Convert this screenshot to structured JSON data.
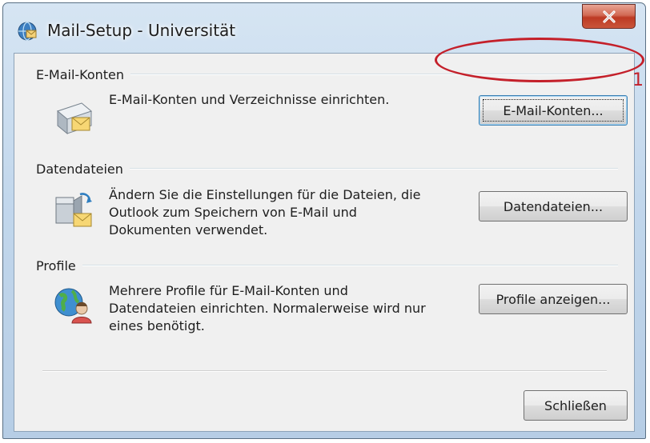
{
  "window": {
    "title": "Mail-Setup - Universität",
    "close_glyph": "x"
  },
  "sections": {
    "accounts": {
      "header": "E-Mail-Konten",
      "description": "E-Mail-Konten und Verzeichnisse einrichten.",
      "button_label": "E-Mail-Konten...",
      "icon": "mail-accounts-icon"
    },
    "datafiles": {
      "header": "Datendateien",
      "description_lines": [
        "Ändern Sie die Einstellungen für die Dateien, die",
        "Outlook zum Speichern von E-Mail und",
        "Dokumenten verwendet."
      ],
      "button_label": "Datendateien...",
      "icon": "data-files-icon"
    },
    "profiles": {
      "header": "Profile",
      "description_lines": [
        "Mehrere Profile für E-Mail-Konten und",
        "Datendateien einrichten. Normalerweise wird nur",
        "eines benötigt."
      ],
      "button_label": "Profile anzeigen...",
      "icon": "profiles-icon"
    }
  },
  "footer": {
    "close_label": "Schließen"
  },
  "annotation": {
    "number": "1",
    "color": "#c4202a"
  }
}
